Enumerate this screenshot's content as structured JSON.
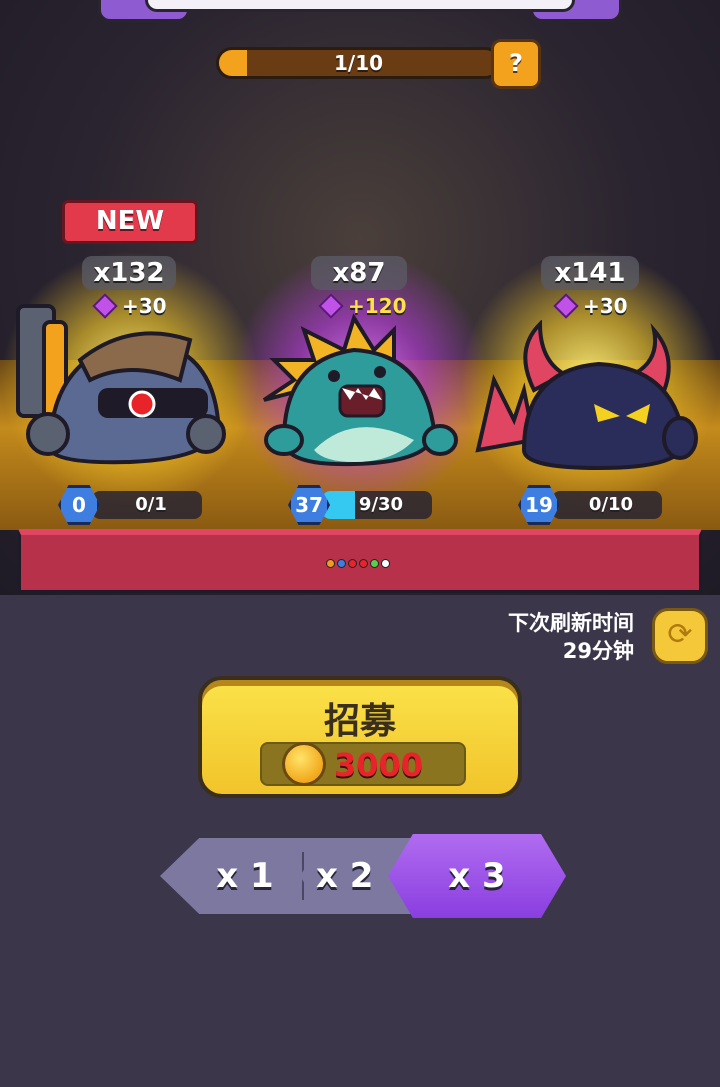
{
  "progress": {
    "text": "1/10",
    "value": 1,
    "max": 10,
    "help_label": "?"
  },
  "new_badge": "NEW",
  "heroes": [
    {
      "count": "x132",
      "gem_bonus": "+30",
      "level": "0",
      "shards": "0/1",
      "shard_value": 0,
      "shard_max": 1
    },
    {
      "count": "x87",
      "gem_bonus": "+120",
      "level": "37",
      "shards": "9/30",
      "shard_value": 9,
      "shard_max": 30
    },
    {
      "count": "x141",
      "gem_bonus": "+30",
      "level": "19",
      "shards": "0/10",
      "shard_value": 0,
      "shard_max": 10
    }
  ],
  "page_dots": [
    "#f39a1c",
    "#3d7ee0",
    "#e8242a",
    "#e8242a",
    "#5ad04a",
    "#ffffff"
  ],
  "refresh": {
    "line1": "下次刷新时间",
    "line2": "29分钟"
  },
  "recruit": {
    "label": "招募",
    "price": "3000"
  },
  "multipliers": [
    {
      "label": "x 1",
      "active": false
    },
    {
      "label": "x 2",
      "active": false
    },
    {
      "label": "x 3",
      "active": true
    }
  ],
  "colors": {
    "accent_gold": "#f1c42a",
    "accent_purple": "#8a3ee0",
    "background": "#3b3649"
  }
}
